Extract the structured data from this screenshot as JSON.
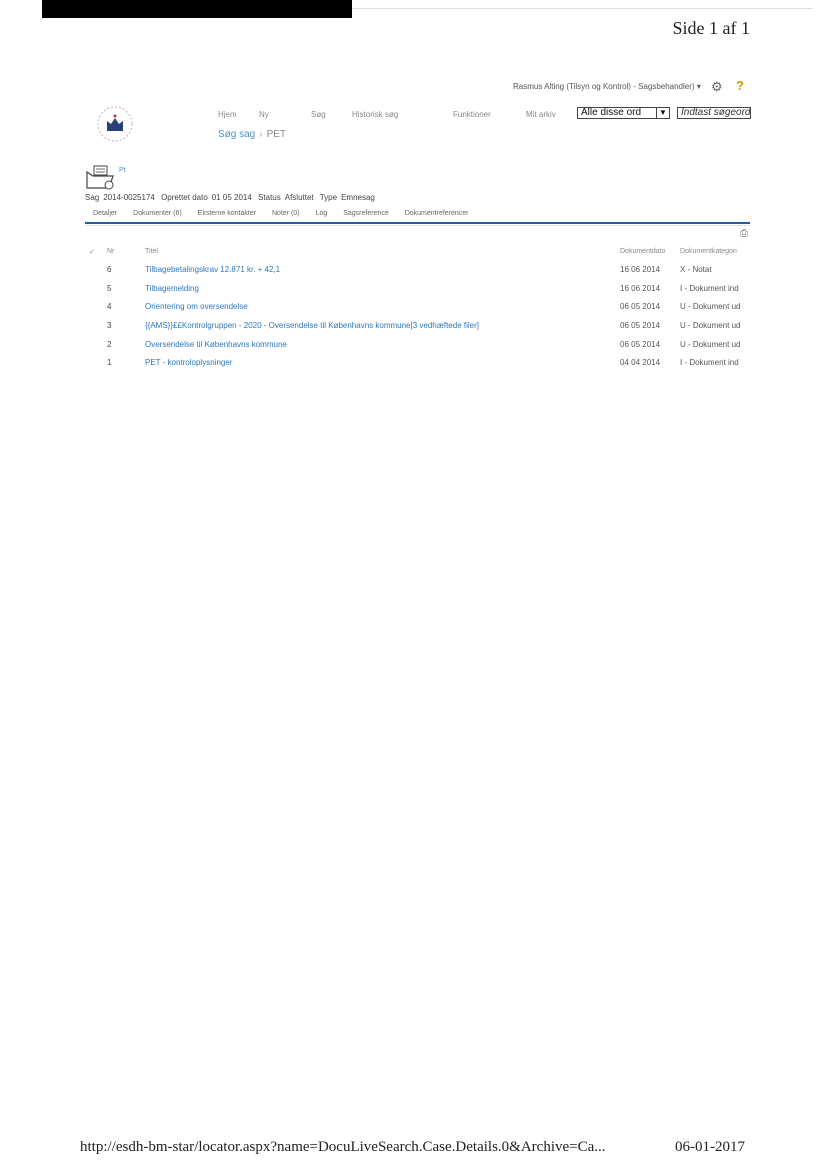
{
  "page_number": "Side 1 af 1",
  "user_line": "Rasmus Alting (Tilsyn og Kontrol) - Sagsbehandler) ▾",
  "nav": {
    "hjem": "Hjem",
    "ny": "Ny",
    "sog": "Søg",
    "historisk": "Historisk søg",
    "funktioner": "Funktioner",
    "mitarkiv": "Mit arkiv"
  },
  "search": {
    "mode": "Alle disse ord",
    "placeholder": "Indtast søgeord"
  },
  "breadcrumb": {
    "root": "Søg sag",
    "current": "PET"
  },
  "case": {
    "icon_label": "Pt",
    "sag_label": "Sag",
    "sag": "2014-0025174",
    "oprettet_label": "Oprettet dato",
    "oprettet": "01 05 2014",
    "status_label": "Status",
    "status": "Afsluttet",
    "type_label": "Type",
    "type": "Emnesag"
  },
  "tabs": [
    "Detaljer",
    "Dokumenter (6)",
    "Eksterne kontakter",
    "Noter (0)",
    "Log",
    "Sagsreference",
    "Dokumentreferencer"
  ],
  "columns": {
    "check": "✓",
    "nr": "Nr",
    "title": "Titel",
    "date": "Dokumentdato",
    "category": "Dokumentkategori"
  },
  "rows": [
    {
      "nr": "6",
      "title": "Tilbagebetalingskrav 12.871 kr. + 42,1",
      "date": "16 06 2014",
      "category": "X - Notat"
    },
    {
      "nr": "5",
      "title": "Tilbagemelding",
      "date": "16 06 2014",
      "category": "I - Dokument ind"
    },
    {
      "nr": "4",
      "title": "Orientering om oversendelse",
      "date": "06 05 2014",
      "category": "U - Dokument ud"
    },
    {
      "nr": "3",
      "title": "{{AMS}}££Kontrolgruppen -                    2020 - Oversendelse til Københavns kommune[3 vedhæftede filer]",
      "date": "06 05 2014",
      "category": "U - Dokument ud"
    },
    {
      "nr": "2",
      "title": "Oversendelse til Københavns kommune",
      "date": "06 05 2014",
      "category": "U - Dokument ud"
    },
    {
      "nr": "1",
      "title": "PET - kontroloplysninger",
      "date": "04 04 2014",
      "category": "I - Dokument ind"
    }
  ],
  "footer": {
    "url": "http://esdh-bm-star/locator.aspx?name=DocuLiveSearch.Case.Details.0&Archive=Ca...",
    "date": "06-01-2017"
  }
}
